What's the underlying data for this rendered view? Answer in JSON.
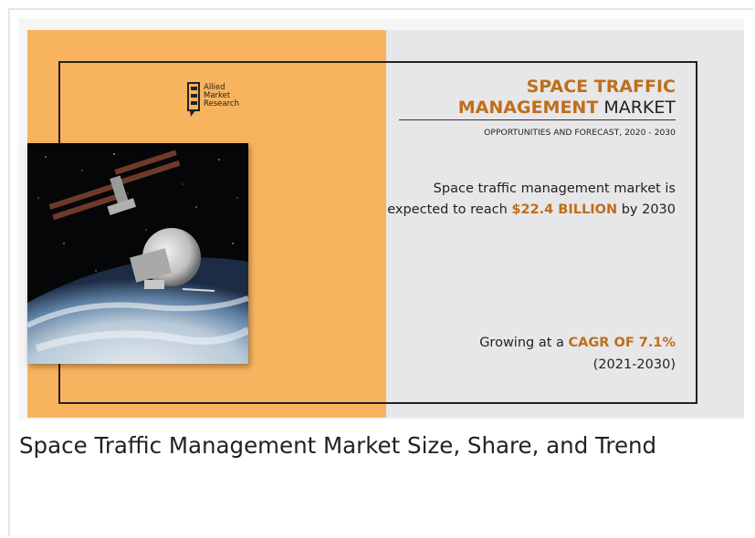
{
  "logo": {
    "line1": "Allied",
    "line2": "Market",
    "line3": "Research"
  },
  "title": {
    "line1": "SPACE TRAFFIC",
    "highlight": "MANAGEMENT",
    "suffix": " MARKET"
  },
  "subtitle": "OPPORTUNITIES AND FORECAST, 2020 - 2030",
  "forecast": {
    "prefix": "Space traffic management market is expected to reach ",
    "value": "$22.4 BILLION",
    "suffix": " by 2030"
  },
  "cagr": {
    "prefix": "Growing at a ",
    "value": "CAGR OF 7.1%",
    "period": "(2021-2030)"
  },
  "caption": "Space Traffic Management Market Size, Share, and Trend",
  "colors": {
    "accent": "#bf6e1b",
    "left_panel": "#f7b35e",
    "right_panel": "#e7e7e9"
  },
  "image": {
    "icon": "space-station-photo"
  }
}
